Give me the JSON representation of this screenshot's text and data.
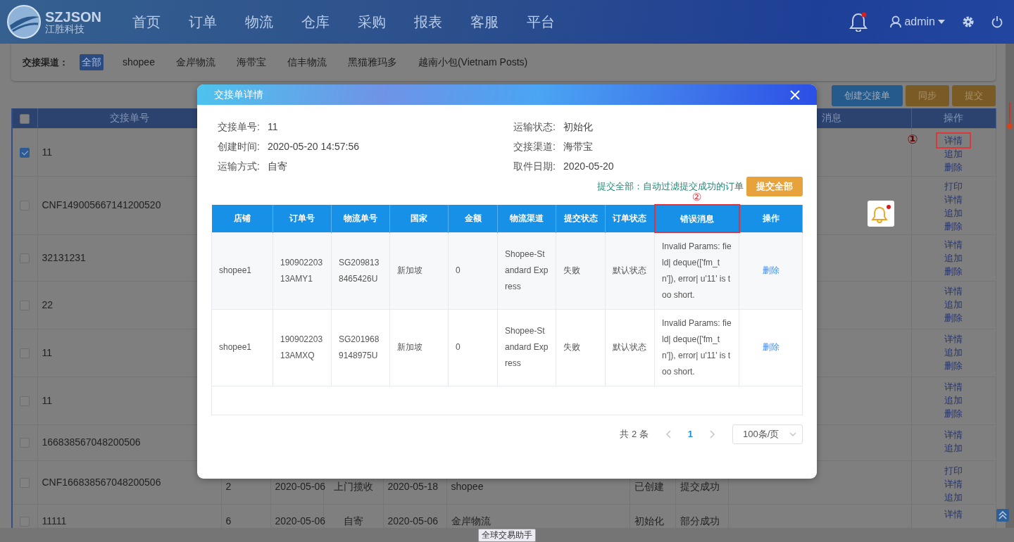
{
  "brand": {
    "name": "SZJSON",
    "subtitle": "江胜科技"
  },
  "nav": [
    {
      "label": "首页"
    },
    {
      "label": "订单"
    },
    {
      "label": "物流"
    },
    {
      "label": "仓库"
    },
    {
      "label": "采购"
    },
    {
      "label": "报表"
    },
    {
      "label": "客服"
    },
    {
      "label": "平台"
    }
  ],
  "user": {
    "name": "admin",
    "has_notification": true
  },
  "filter": {
    "label": "交接渠道：",
    "channels": [
      {
        "label": "全部",
        "selected": true
      },
      {
        "label": "shopee",
        "selected": false
      },
      {
        "label": "金岸物流",
        "selected": false
      },
      {
        "label": "海带宝",
        "selected": false
      },
      {
        "label": "信丰物流",
        "selected": false
      },
      {
        "label": "黑猫雅玛多",
        "selected": false
      },
      {
        "label": "越南小包(Vietnam Posts)",
        "selected": false
      }
    ]
  },
  "toolbar": [
    {
      "label": "创建交接单",
      "kind": "primary"
    },
    {
      "label": "同步",
      "kind": "warning"
    },
    {
      "label": "提交",
      "kind": "warning"
    }
  ],
  "table": {
    "all_checked": false,
    "columns": {
      "order_no": "交接单号",
      "column_10": "消息",
      "actions": "操作"
    },
    "rows": [
      {
        "checked": true,
        "number": "11",
        "actions": [
          {
            "label": "详情",
            "highlighted": true,
            "marker": "①"
          },
          {
            "label": "追加",
            "highlighted": false
          },
          {
            "label": "删除",
            "highlighted": false
          }
        ]
      },
      {
        "checked": false,
        "number": "CNF149005667141200520",
        "actions": [
          {
            "label": "打印",
            "highlighted": false
          },
          {
            "label": "详情",
            "highlighted": false
          },
          {
            "label": "追加",
            "highlighted": false
          },
          {
            "label": "删除",
            "highlighted": false
          }
        ]
      },
      {
        "checked": false,
        "number": "32131231",
        "actions": [
          {
            "label": "详情",
            "highlighted": false
          },
          {
            "label": "追加",
            "highlighted": false
          },
          {
            "label": "删除",
            "highlighted": false
          }
        ]
      },
      {
        "checked": false,
        "number": "22",
        "actions": [
          {
            "label": "详情",
            "highlighted": false
          },
          {
            "label": "追加",
            "highlighted": false
          },
          {
            "label": "删除",
            "highlighted": false
          }
        ]
      },
      {
        "checked": false,
        "number": "11",
        "actions": [
          {
            "label": "详情",
            "highlighted": false
          },
          {
            "label": "追加",
            "highlighted": false
          },
          {
            "label": "删除",
            "highlighted": false
          }
        ]
      },
      {
        "checked": false,
        "number": "11",
        "actions": [
          {
            "label": "详情",
            "highlighted": false
          },
          {
            "label": "追加",
            "highlighted": false
          },
          {
            "label": "删除",
            "highlighted": false
          }
        ]
      },
      {
        "checked": false,
        "number": "166838567048200506",
        "actions": [
          {
            "label": "详情",
            "highlighted": false
          },
          {
            "label": "追加",
            "highlighted": false
          }
        ]
      },
      {
        "checked": false,
        "number": "CNF166838567048200506",
        "cells": [
          "2",
          "2020-05-06",
          "上门揽收",
          "2020-05-18",
          "shopee",
          "已创建",
          "提交成功"
        ],
        "actions": [
          {
            "label": "打印",
            "highlighted": false
          },
          {
            "label": "详情",
            "highlighted": false
          },
          {
            "label": "追加",
            "highlighted": false
          }
        ]
      },
      {
        "checked": false,
        "number": "11111",
        "cells": [
          "6",
          "2020-05-06",
          "自寄",
          "2020-05-06",
          "金岸物流",
          "初始化",
          "部分成功"
        ],
        "actions": [
          {
            "label": "详情",
            "highlighted": false
          }
        ]
      }
    ]
  },
  "modal": {
    "title": "交接单详情",
    "fields": [
      {
        "label": "交接单号:",
        "value": "11"
      },
      {
        "label": "运输状态:",
        "value": "初始化"
      },
      {
        "label": "创建时间:",
        "value": "2020-05-20 14:57:56"
      },
      {
        "label": "交接渠道:",
        "value": "海带宝"
      },
      {
        "label": "运输方式:",
        "value": "自寄"
      },
      {
        "label": "取件日期:",
        "value": "2020-05-20"
      }
    ],
    "note": "提交全部：自动过滤提交成功的订单",
    "submit_all": "提交全部",
    "columns": [
      {
        "label": "店铺",
        "highlighted": false
      },
      {
        "label": "订单号",
        "highlighted": false
      },
      {
        "label": "物流单号",
        "highlighted": false
      },
      {
        "label": "国家",
        "highlighted": false
      },
      {
        "label": "金额",
        "highlighted": false
      },
      {
        "label": "物流渠道",
        "highlighted": false
      },
      {
        "label": "提交状态",
        "highlighted": false
      },
      {
        "label": "订单状态",
        "highlighted": false
      },
      {
        "label": "错误消息",
        "highlighted": true,
        "marker": "②"
      },
      {
        "label": "操作",
        "highlighted": false
      }
    ],
    "rows": [
      {
        "cells": [
          "shopee1",
          "19090220313AMY1",
          "SG2098138465426U",
          "新加坡",
          "0",
          "Shopee-Standard Express",
          "失败",
          "默认状态",
          "Invalid Params: field| deque(['fm_tn']), error| u'11' is too short."
        ],
        "action": "删除"
      },
      {
        "cells": [
          "shopee1",
          "19090220313AMXQ",
          "SG2019689148975U",
          "新加坡",
          "0",
          "Shopee-Standard Express",
          "失败",
          "默认状态",
          "Invalid Params: field| deque(['fm_tn']), error| u'11' is too short."
        ],
        "action": "删除"
      }
    ],
    "pagination": {
      "total": "共 2 条",
      "pages": [
        {
          "label": "1",
          "selected": true
        }
      ],
      "page_size": "100条/页"
    }
  },
  "assistant_label": "全球交易助手"
}
